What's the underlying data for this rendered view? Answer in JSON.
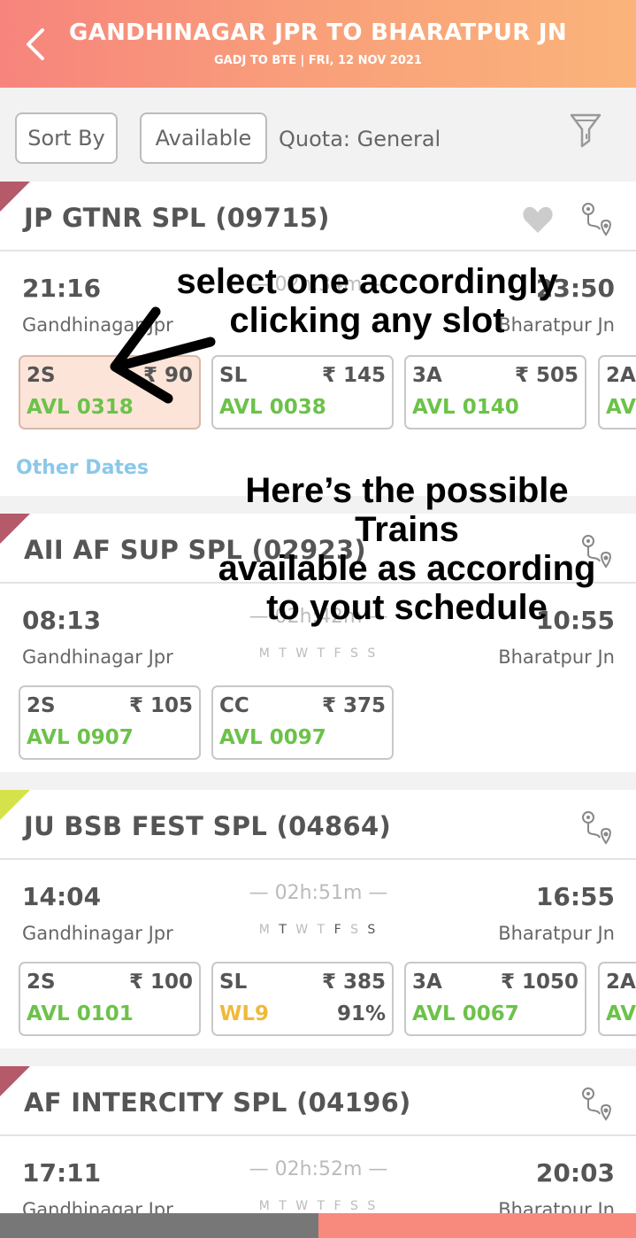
{
  "header": {
    "title": "GANDHINAGAR JPR TO BHARATPUR JN",
    "subtitle": "GADJ TO BTE | FRI, 12 NOV  2021"
  },
  "filters": {
    "sort_label": "Sort By",
    "available_label": "Available",
    "quota_label": "Quota:",
    "quota_value": "General"
  },
  "trains": [
    {
      "name": "JP GTNR SPL (09715)",
      "dep": "21:16",
      "arr": "23:50",
      "duration": "02h:34m",
      "from": "Gandhinagar Jpr",
      "to": "Bharatpur Jn",
      "classes": [
        {
          "cls": "2S",
          "price": "₹ 90",
          "avl": "AVL 0318"
        },
        {
          "cls": "SL",
          "price": "₹ 145",
          "avl": "AVL 0038"
        },
        {
          "cls": "3A",
          "price": "₹ 505",
          "avl": "AVL 0140"
        },
        {
          "cls": "2A",
          "price": "",
          "avl": "AV"
        }
      ],
      "other_dates": "Other Dates"
    },
    {
      "name": "AII AF SUP SPL (02923)",
      "dep": "08:13",
      "arr": "10:55",
      "duration": "02h:42m",
      "days": "M T W T F S S",
      "from": "Gandhinagar Jpr",
      "to": "Bharatpur Jn",
      "classes": [
        {
          "cls": "2S",
          "price": "₹ 105",
          "avl": "AVL 0907"
        },
        {
          "cls": "CC",
          "price": "₹ 375",
          "avl": "AVL 0097"
        }
      ]
    },
    {
      "name": "JU BSB FEST SPL (04864)",
      "dep": "14:04",
      "arr": "16:55",
      "duration": "02h:51m",
      "days": [
        "M",
        "T",
        "W",
        "T",
        "F",
        "S",
        "S"
      ],
      "from": "Gandhinagar Jpr",
      "to": "Bharatpur Jn",
      "classes": [
        {
          "cls": "2S",
          "price": "₹ 100",
          "avl": "AVL 0101"
        },
        {
          "cls": "SL",
          "price": "₹ 385",
          "avl": "WL9",
          "pct": "91%"
        },
        {
          "cls": "3A",
          "price": "₹ 1050",
          "avl": "AVL 0067"
        },
        {
          "cls": "2A",
          "price": "",
          "avl": "AV"
        }
      ]
    },
    {
      "name": "AF INTERCITY SPL (04196)",
      "dep": "17:11",
      "arr": "20:03",
      "duration": "02h:52m",
      "days": "M T W T F S S",
      "from": "Gandhinagar Jpr",
      "to": "Bharatpur Jn"
    }
  ],
  "annotations": {
    "select_note": "select one  accordingly clicking any slot",
    "trains_note_1": "Here’s the possible",
    "trains_note_2": "Trains",
    "trains_note_3": "available as according",
    "trains_note_4": "to yout schedule"
  },
  "colors": {
    "header_start": "#f7847d",
    "header_end": "#fab47a",
    "available_green": "#6cc24a",
    "waitlist_amber": "#f0b83c",
    "other_dates_blue": "#8ac8ea"
  },
  "icons": [
    "back-arrow-icon",
    "filter-funnel-icon",
    "heart-icon",
    "route-map-icon"
  ]
}
